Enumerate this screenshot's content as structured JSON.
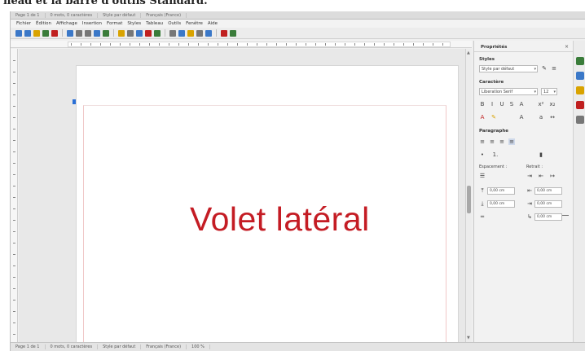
{
  "caption": "head et la barre d'outils Standard.",
  "topbar": [
    "Page 1 de 1",
    "0 mots, 0 caractères",
    "Style par défaut",
    "Français (France)"
  ],
  "menu": [
    "Fichier",
    "Édition",
    "Affichage",
    "Insertion",
    "Format",
    "Styles",
    "Tableau",
    "Outils",
    "Fenêtre",
    "Aide"
  ],
  "toolbar_colors": [
    "#3b78c8",
    "#3b78c8",
    "#d9a300",
    "#3a7c3a",
    "#c02020",
    "#3b78c8",
    "#777777",
    "#777777",
    "#3b78c8",
    "#3a7c3a",
    "#d9a300",
    "#777777",
    "#3b78c8",
    "#c02020",
    "#3a7c3a",
    "#777777",
    "#3b78c8",
    "#d9a300",
    "#777777",
    "#3b78c8",
    "#c02020",
    "#3a7c3a"
  ],
  "document": {
    "title": "Volet latéral"
  },
  "sidebar": {
    "title": "Propriétés",
    "close": "×",
    "styles_section": "Styles",
    "paragraph_style": "Style par défaut",
    "char_section": "Caractère",
    "font_name": "Liberation Serif",
    "font_size": "12",
    "paragraph_section": "Paragraphe",
    "spacing_label": "Espacement :",
    "indent_label": "Retrait :",
    "spin1": "0,00 cm",
    "spin2": "0,00 cm",
    "spin3": "0,00 cm",
    "spin4": "0,00 cm",
    "spin5": "0,00 cm"
  },
  "deck_colors": [
    "#3a7c3a",
    "#3b78c8",
    "#d9a300",
    "#c02020",
    "#777777"
  ],
  "status": [
    "Page 1 de 1",
    "0 mots, 0 caractères",
    "Style par défaut",
    "Français (France)",
    "100 %"
  ]
}
